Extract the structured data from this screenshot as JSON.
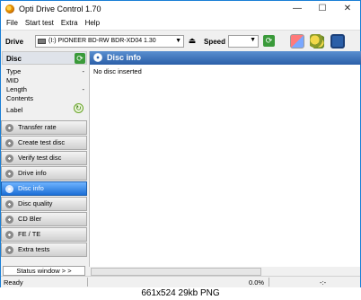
{
  "window": {
    "title": "Opti Drive Control 1.70",
    "controls": {
      "minimize": "—",
      "maximize": "☐",
      "close": "✕"
    }
  },
  "menu": {
    "items": [
      "File",
      "Start test",
      "Extra",
      "Help"
    ]
  },
  "toolbar": {
    "drive_label": "Drive",
    "drive_value": "(I:)  PIONEER BD-RW   BDR-XD04 1.30",
    "speed_label": "Speed",
    "speed_value": "",
    "icons": [
      "refresh-icon",
      "eraser-icon",
      "copy-disc-icon",
      "save-icon"
    ]
  },
  "disc_panel": {
    "header": "Disc",
    "properties": [
      {
        "label": "Type",
        "value": "-"
      },
      {
        "label": "MID",
        "value": ""
      },
      {
        "label": "Length",
        "value": "-"
      },
      {
        "label": "Contents",
        "value": ""
      }
    ],
    "label_field": "Label"
  },
  "nav": {
    "items": [
      {
        "label": "Transfer rate",
        "active": false
      },
      {
        "label": "Create test disc",
        "active": false
      },
      {
        "label": "Verify test disc",
        "active": false
      },
      {
        "label": "Drive info",
        "active": false
      },
      {
        "label": "Disc info",
        "active": true
      },
      {
        "label": "Disc quality",
        "active": false
      },
      {
        "label": "CD Bler",
        "active": false
      },
      {
        "label": "FE / TE",
        "active": false
      },
      {
        "label": "Extra tests",
        "active": false
      }
    ],
    "status_window_button": "Status window > >"
  },
  "main": {
    "title": "Disc info",
    "message": "No disc inserted"
  },
  "status": {
    "ready": "Ready",
    "progress_text": "0.0%",
    "progress_fraction": 0.0,
    "timer": "-:-"
  },
  "caption": "661x524  29kb  PNG",
  "colors": {
    "accent": "#2b5fa8",
    "active_nav": "#1c6fd6",
    "progress": "#06b025",
    "window_border": "#1a7fd6"
  }
}
